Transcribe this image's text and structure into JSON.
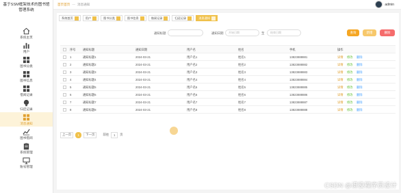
{
  "app": {
    "title": "基于SSM框架技术的图书馆管理系统",
    "user": "admin"
  },
  "breadcrumb": {
    "first": "首页首页",
    "second": "消息通知"
  },
  "sidebar": {
    "items": [
      {
        "label": "系统主页",
        "icon": "home-icon"
      },
      {
        "label": "用户",
        "icon": "bar-chart-icon"
      },
      {
        "label": "图书分类",
        "icon": "grid-icon"
      },
      {
        "label": "图书信息",
        "icon": "grid-icon"
      },
      {
        "label": "借阅记录",
        "icon": "grid-icon"
      },
      {
        "label": "归还记录",
        "icon": "bulb-icon"
      },
      {
        "label": "消息通知",
        "icon": "grid-icon",
        "active": true
      },
      {
        "label": "图书借阅",
        "icon": "trend-icon"
      },
      {
        "label": "系统管理",
        "icon": "clipboard-icon"
      },
      {
        "label": "账号管理",
        "icon": "monitor-icon"
      }
    ]
  },
  "tabs": [
    {
      "label": "系统首页"
    },
    {
      "label": "用户"
    },
    {
      "label": "图书分类"
    },
    {
      "label": "图书信息"
    },
    {
      "label": "借阅记录"
    },
    {
      "label": "归还记录"
    },
    {
      "label": "消息通知",
      "active": true
    }
  ],
  "search": {
    "title_label": "通知标题",
    "title_placeholder": "",
    "date_label": "通知日期",
    "date_from_placeholder": "开始日期",
    "date_sep": "至",
    "date_to_placeholder": "结束日期",
    "search_btn": "查询",
    "add_btn": "新增",
    "delete_btn": "删除"
  },
  "table": {
    "headers": [
      "序号",
      "通知标题",
      "通知日期",
      "用户名",
      "姓名",
      "手机",
      "操作"
    ],
    "rows": [
      [
        "1",
        "通知标题1",
        "2024-03-21",
        "用户名1",
        "姓名1",
        "13823888881"
      ],
      [
        "2",
        "通知标题2",
        "2024-03-21",
        "用户名2",
        "姓名2",
        "13823888882"
      ],
      [
        "3",
        "通知标题3",
        "2024-03-21",
        "用户名3",
        "姓名3",
        "13823888883"
      ],
      [
        "4",
        "通知标题4",
        "2024-03-21",
        "用户名4",
        "姓名4",
        "13823888884"
      ],
      [
        "5",
        "通知标题5",
        "2024-03-21",
        "用户名5",
        "姓名5",
        "13823888885"
      ],
      [
        "6",
        "通知标题6",
        "2024-03-21",
        "用户名6",
        "姓名6",
        "13823888886"
      ],
      [
        "7",
        "通知标题7",
        "2024-03-21",
        "用户名7",
        "姓名7",
        "13823888887"
      ],
      [
        "8",
        "通知标题8",
        "2024-03-21",
        "用户名8",
        "姓名8",
        "13823888888"
      ]
    ],
    "actions": {
      "view": "详情",
      "edit": "修改",
      "delete": "删除"
    }
  },
  "pagination": {
    "prev": "上一页",
    "page": "1",
    "next": "下一页",
    "goto_label": "前往",
    "goto_value": "1",
    "page_unit": "页"
  },
  "watermark": "CSDN @退役程序员设计",
  "colors": {
    "accent": "#f0c14b",
    "search_btn": "#f5a623",
    "add_btn": "#f7c86b",
    "delete_btn": "#f56c6c"
  }
}
